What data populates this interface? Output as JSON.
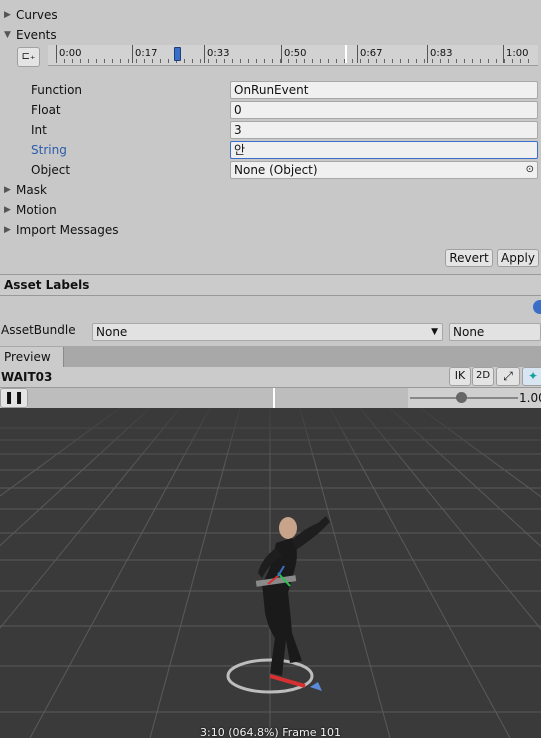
{
  "foldouts": {
    "curves": "Curves",
    "events": "Events",
    "mask": "Mask",
    "motion": "Motion",
    "import_messages": "Import Messages"
  },
  "timeline": {
    "ticks": [
      "0:00",
      "0:17",
      "0:33",
      "0:50",
      "0:67",
      "0:83",
      "1:00"
    ]
  },
  "event": {
    "function_label": "Function",
    "function_value": "OnRunEvent",
    "float_label": "Float",
    "float_value": "0",
    "int_label": "Int",
    "int_value": "3",
    "string_label": "String",
    "string_value": "안",
    "object_label": "Object",
    "object_value": "None (Object)"
  },
  "buttons": {
    "revert": "Revert",
    "apply": "Apply"
  },
  "asset_labels": {
    "title": "Asset Labels",
    "assetbundle_label": "AssetBundle",
    "assetbundle_value": "None",
    "variant_value": "None"
  },
  "preview": {
    "tab": "Preview",
    "clip_name": "WAIT03",
    "ik": "IK",
    "two_d": "2D",
    "speed": "1.00",
    "status": "3:10 (064.8%) Frame 101",
    "colors": {
      "viewport_bg": "#3a3a3a",
      "grid_line": "#555555",
      "accent_blue": "#3a6ec8"
    }
  }
}
